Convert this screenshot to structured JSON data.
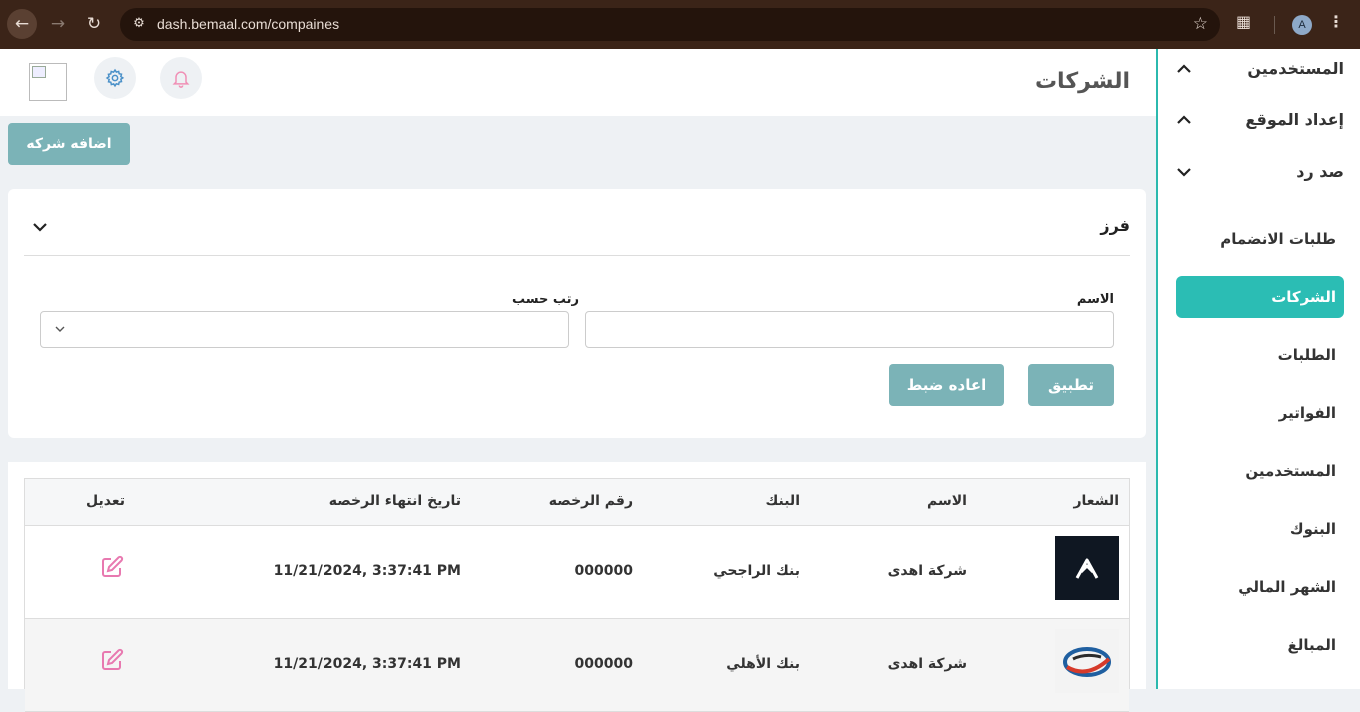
{
  "browser": {
    "url": "dash.bemaal.com/compaines",
    "profile_initial": "A"
  },
  "sidebar": {
    "groups": [
      {
        "label": "المستخدمين",
        "state": "expanded"
      },
      {
        "label": "إعداد الموقع",
        "state": "expanded"
      },
      {
        "label": "صد رد",
        "state": "collapsed"
      }
    ],
    "items": [
      {
        "label": "طلبات الانضمام",
        "active": false
      },
      {
        "label": "الشركات",
        "active": true
      },
      {
        "label": "الطلبات",
        "active": false
      },
      {
        "label": "الفواتير",
        "active": false
      },
      {
        "label": "المستخدمين",
        "active": false
      },
      {
        "label": "البنوك",
        "active": false
      },
      {
        "label": "الشهر المالي",
        "active": false
      },
      {
        "label": "المبالغ",
        "active": false
      }
    ]
  },
  "header": {
    "title": "الشركات",
    "icons": [
      "bell-icon",
      "gear-icon",
      "avatar-image"
    ]
  },
  "actions": {
    "add_company_label": "اضافه شركه"
  },
  "filter": {
    "title": "فرز",
    "name_label": "الاسم",
    "name_value": "",
    "sort_label": "رتب حسب",
    "sort_value": "",
    "apply_label": "تطبيق",
    "reset_label": "اعاده ضبط"
  },
  "table": {
    "headers": {
      "logo": "الشعار",
      "name": "الاسم",
      "bank": "البنك",
      "license_number": "رقم الرخصه",
      "license_expiry": "تاريخ انتهاء الرخصه",
      "edit": "تعديل"
    },
    "rows": [
      {
        "name": "شركة اهدى",
        "bank": "بنك الراجحي",
        "license_number": "000000",
        "license_expiry": "11/21/2024, 3:37:41 PM",
        "logo": "dark-chevron-logo"
      },
      {
        "name": "شركة اهدى",
        "bank": "بنك الأهلي",
        "license_number": "000000",
        "license_expiry": "11/21/2024, 3:37:41 PM",
        "logo": "swoosh-logo"
      }
    ]
  },
  "colors": {
    "accent": "#2bbdb4",
    "button": "#7bb3b7",
    "edit_icon": "#e879b0",
    "bell_icon": "#f08fb5",
    "gear_icon": "#4a90c8"
  }
}
